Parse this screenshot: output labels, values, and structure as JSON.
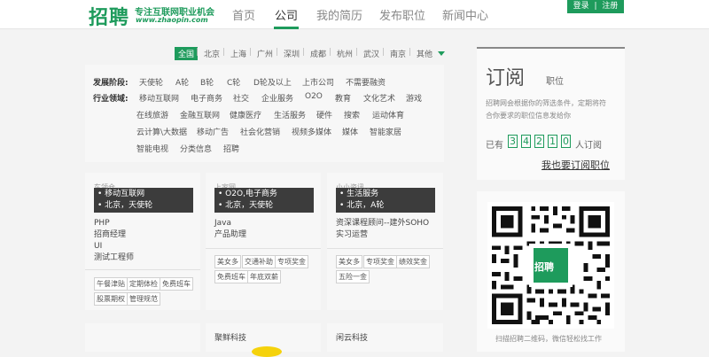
{
  "header": {
    "logo": "招聘",
    "slogan": "专注互联网职业机会",
    "url": "www.zhaopin.com",
    "nav": [
      "首页",
      "公司",
      "我的简历",
      "发布职位",
      "新闻中心"
    ],
    "active_nav": "公司",
    "login": "登录",
    "divider": "|",
    "register": "注册"
  },
  "cities": [
    "全国",
    "北京",
    "上海",
    "广州",
    "深圳",
    "成都",
    "杭州",
    "武汉",
    "南京",
    "其他"
  ],
  "active_city": "全国",
  "filters": {
    "stage_label": "发展阶段:",
    "stages": [
      "天使轮",
      "A轮",
      "B轮",
      "C轮",
      "D轮及以上",
      "上市公司",
      "不需要融资"
    ],
    "industry_label": "行业领域:",
    "industries_row1": [
      "移动互联网",
      "电子商务",
      "社交",
      "企业服务",
      "O2O",
      "教育",
      "文化艺术",
      "游戏"
    ],
    "industries_row2": [
      "在线旅游",
      "金融互联网",
      "健康医疗",
      "生活服务",
      "硬件",
      "搜索",
      "运动体育"
    ],
    "industries_row3": [
      "云计算\\大数据",
      "移动广告",
      "社会化营销",
      "视频多媒体",
      "媒体",
      "智能家居"
    ],
    "industries_row4": [
      "智能电视",
      "分类信息",
      "招聘"
    ]
  },
  "cards": [
    {
      "ghost": "车领仓",
      "industry": "• 移动互联网",
      "location": "• 北京，天使轮",
      "jobs": [
        "PHP",
        "招商经理",
        "UI",
        "测试工程师"
      ],
      "tags": [
        [
          "午餐津贴",
          "定期体检",
          "免费班车"
        ],
        [
          "股票期权",
          "管理规范"
        ]
      ]
    },
    {
      "ghost": "上家网",
      "industry": "• O2O,电子商务",
      "location": "• 北京，天使轮",
      "jobs": [
        "Java",
        "产品助理"
      ],
      "tags": [
        [
          "美女多",
          "交通补助",
          "专项奖金"
        ],
        [
          "免费班车",
          "年底双薪"
        ]
      ]
    },
    {
      "ghost": "小小资讯",
      "industry": "• 生活服务",
      "location": "• 北京，A轮",
      "jobs": [
        "资深课程顾问--建外SOHO",
        "实习运营"
      ],
      "tags": [
        [
          "美女多",
          "专项奖金",
          "绩效奖金"
        ],
        [
          "五险一金"
        ]
      ]
    }
  ],
  "next_cards": [
    "聚鲜科技",
    "闲云科技"
  ],
  "subscribe": {
    "title": "订阅",
    "subtitle": "职位",
    "desc": [
      "招聘网会根据你的筛选条件，定期将符",
      "合你要求的职位信息发给你"
    ],
    "prefix": "已有",
    "digits": [
      "3",
      "4",
      "2",
      "1",
      "0"
    ],
    "suffix": "人订阅",
    "link": "我也要订阅职位"
  },
  "qr": {
    "center_label": "招聘",
    "caption": "扫描招聘二维码，微信轻松找工作"
  },
  "colors": {
    "brand": "#1e9b5c",
    "banner": "#3c3c3c"
  }
}
